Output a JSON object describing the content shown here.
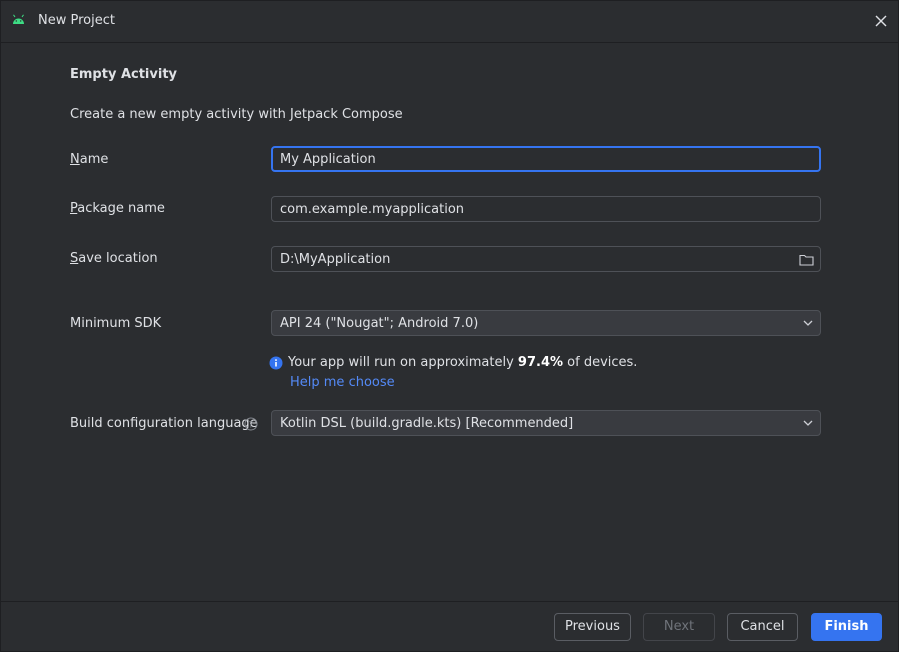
{
  "window": {
    "title": "New Project"
  },
  "template": {
    "heading": "Empty Activity",
    "description": "Create a new empty activity with Jetpack Compose"
  },
  "form": {
    "name": {
      "label_mnemonic": "N",
      "label_rest": "ame",
      "value": "My Application"
    },
    "package": {
      "label_mnemonic": "P",
      "label_rest": "ackage name",
      "value": "com.example.myapplication"
    },
    "save_location": {
      "label_mnemonic": "S",
      "label_rest": "ave location",
      "value": "D:\\MyApplication"
    },
    "min_sdk": {
      "label": "Minimum SDK",
      "value": "API 24 (\"Nougat\"; Android 7.0)"
    },
    "sdk_info": {
      "prefix": "Your app will run on approximately ",
      "percent": "97.4%",
      "suffix": " of devices.",
      "help_link": "Help me choose"
    },
    "build_lang": {
      "label": "Build configuration language",
      "value": "Kotlin DSL (build.gradle.kts) [Recommended]"
    }
  },
  "buttons": {
    "previous": "Previous",
    "next": "Next",
    "cancel": "Cancel",
    "finish": "Finish"
  },
  "colors": {
    "accent": "#3574f0",
    "link": "#548af7",
    "android_green": "#3ddc84",
    "background": "#2b2d30"
  },
  "icons": [
    "android-icon",
    "close-icon",
    "folder-icon",
    "chevron-down-icon",
    "info-icon",
    "question-icon"
  ]
}
